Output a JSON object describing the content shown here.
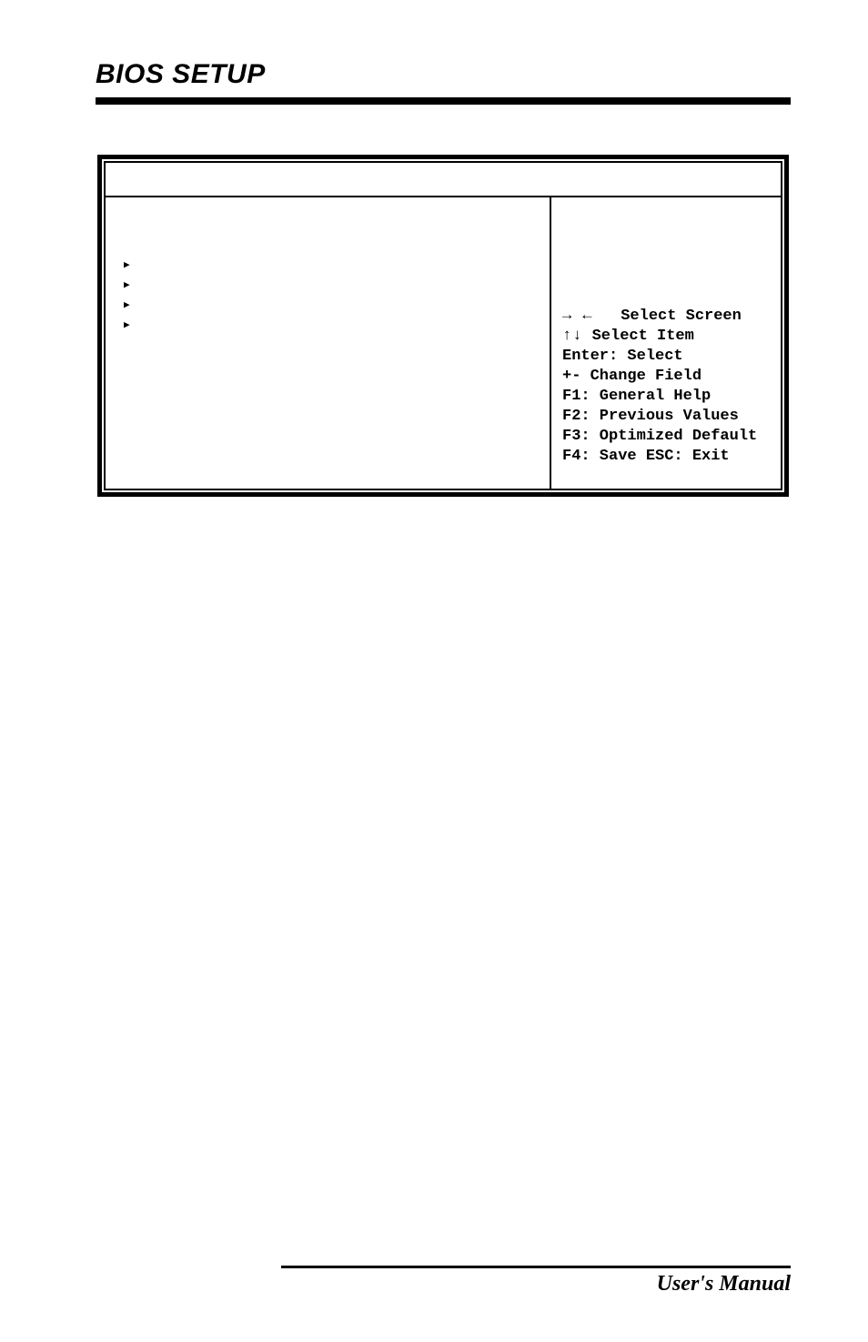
{
  "page": {
    "header": "BIOS SETUP",
    "footer": "User's Manual"
  },
  "bios": {
    "nav": {
      "line1_arrows": "→  ←",
      "line1_label": "Select Screen",
      "line2_arrows": "↑↓",
      "line2_label": "Select Item",
      "line3": "Enter: Select",
      "line4": "+-  Change Field",
      "line5": "F1: General Help",
      "line6": "F2: Previous Values",
      "line7": "F3: Optimized Default",
      "line8": "F4: Save  ESC: Exit"
    }
  }
}
